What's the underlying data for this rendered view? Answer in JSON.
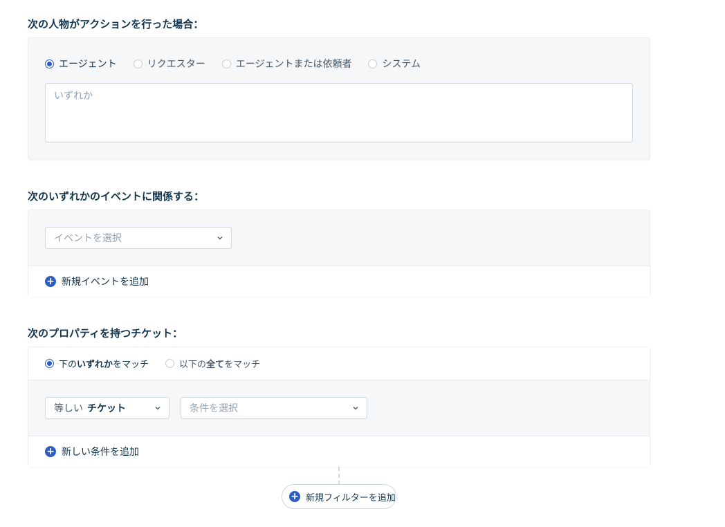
{
  "actor_section": {
    "title": "次の人物がアクションを行った場合：",
    "options": [
      {
        "label": "エージェント",
        "checked": true
      },
      {
        "label": "リクエスター",
        "checked": false
      },
      {
        "label": "エージェントまたは依頼者",
        "checked": false
      },
      {
        "label": "システム",
        "checked": false
      }
    ],
    "input_placeholder": "いずれか"
  },
  "event_section": {
    "title": "次のいずれかのイベントに関係する：",
    "select_placeholder": "イベントを選択",
    "add_label": "新規イベントを追加"
  },
  "ticket_section": {
    "title": "次のプロパティを持つチケット：",
    "match_any": {
      "prefix": "下の",
      "bold": "いずれか",
      "suffix": "をマッチ",
      "checked": true
    },
    "match_all": {
      "prefix": "以下の",
      "bold": "全て",
      "suffix": "をマッチ",
      "checked": false
    },
    "operator_select": {
      "normal": "等しい",
      "bold": "チケット"
    },
    "condition_placeholder": "条件を選択",
    "add_label": "新しい条件を追加"
  },
  "add_filter_label": "新規フィルターを追加",
  "colors": {
    "accent": "#2c5cc5",
    "card_bg": "#f5f7f9",
    "text": "#12344d"
  },
  "icons": [
    "plus-circle-icon",
    "chevron-down-icon"
  ]
}
